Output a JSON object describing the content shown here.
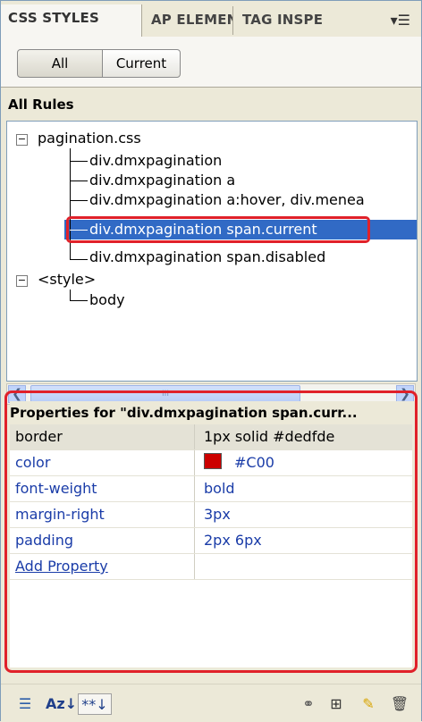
{
  "tabs": [
    {
      "label": "CSS STYLES"
    },
    {
      "label": "AP ELEMEN"
    },
    {
      "label": "TAG INSPE"
    }
  ],
  "panel_menu_icon": "options-menu-icon",
  "toggle": {
    "all_label": "All",
    "current_label": "Current",
    "selected": "All"
  },
  "section_title": "All Rules",
  "tree": {
    "files": [
      {
        "name": "pagination.css",
        "expanded": true,
        "rules": [
          "div.dmxpagination",
          "div.dmxpagination a",
          "div.dmxpagination a:hover, div.menea",
          "div.dmxpagination span.current",
          "div.dmxpagination span.disabled"
        ]
      },
      {
        "name": "<style>",
        "expanded": true,
        "rules": [
          "body"
        ]
      }
    ],
    "selected_rule": "div.dmxpagination span.current"
  },
  "scrollbar": {
    "thumb_grip": "III"
  },
  "properties": {
    "header": "Properties for \"div.dmxpagination span.curr...",
    "rows": [
      {
        "name": "border",
        "value": "1px solid #dedfde"
      },
      {
        "name": "color",
        "value": "#C00",
        "swatch": "#cc0000"
      },
      {
        "name": "font-weight",
        "value": "bold"
      },
      {
        "name": "margin-right",
        "value": "3px"
      },
      {
        "name": "padding",
        "value": "2px 6px"
      }
    ],
    "add_property_label": "Add Property"
  },
  "toolbar": {
    "category_view_icon": "category-view-icon",
    "list_view_icon": "az-list-view-icon",
    "set_properties_icon": "set-properties-view-icon",
    "az_label": "Az↓",
    "set_label": "**↓",
    "attach_icon": "attach-stylesheet-icon",
    "new_rule_icon": "new-css-rule-icon",
    "edit_icon": "edit-style-icon",
    "delete_icon": "delete-css-rule-icon"
  },
  "colors": {
    "selection": "#316ac5",
    "highlight_border": "#e0212a",
    "link_blue": "#1a3ca8"
  }
}
